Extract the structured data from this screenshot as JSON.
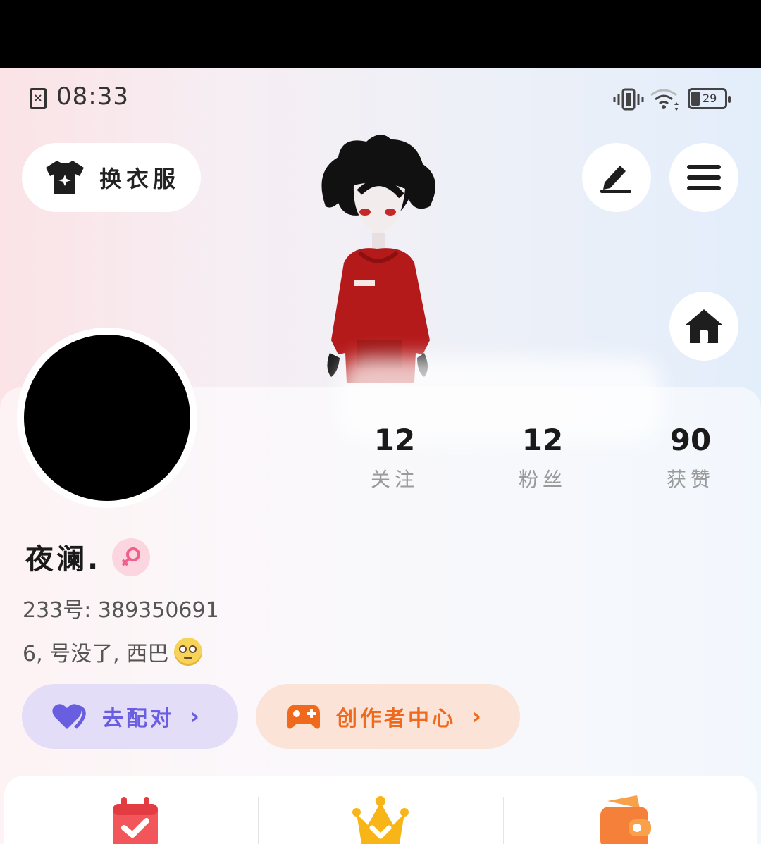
{
  "status_bar": {
    "time": "08:33",
    "sim_icon": "sim-off-icon",
    "battery": "29",
    "icons": [
      "vibrate-icon",
      "wifi-icon",
      "battery-icon"
    ]
  },
  "header": {
    "outfit_label": "换衣服",
    "outfit_icon": "tshirt-icon",
    "edit_icon": "edit-icon",
    "menu_icon": "menu-icon",
    "home_icon": "home-icon"
  },
  "profile": {
    "username": "夜澜.",
    "gender_icon": "female-icon",
    "user_id": "233号: 389350691",
    "bio": "6, 号没了, 西巴",
    "bio_emoji": "eye-roll-emoji-icon"
  },
  "stats": {
    "follow": {
      "value": "12",
      "label": "关注"
    },
    "fans": {
      "value": "12",
      "label": "粉丝"
    },
    "likes": {
      "value": "90",
      "label": "获赞"
    }
  },
  "actions": {
    "match": {
      "label": "去配对",
      "icon": "heart-icon"
    },
    "creator": {
      "label": "创作者中心",
      "icon": "gamepad-icon"
    }
  },
  "bottom": {
    "icons": [
      "calendar-check-icon",
      "crown-icon",
      "wallet-icon"
    ]
  },
  "colors": {
    "match_accent": "#6a5ee0",
    "creator_accent": "#f06a1e",
    "gender_badge": "#fbd6e1"
  }
}
